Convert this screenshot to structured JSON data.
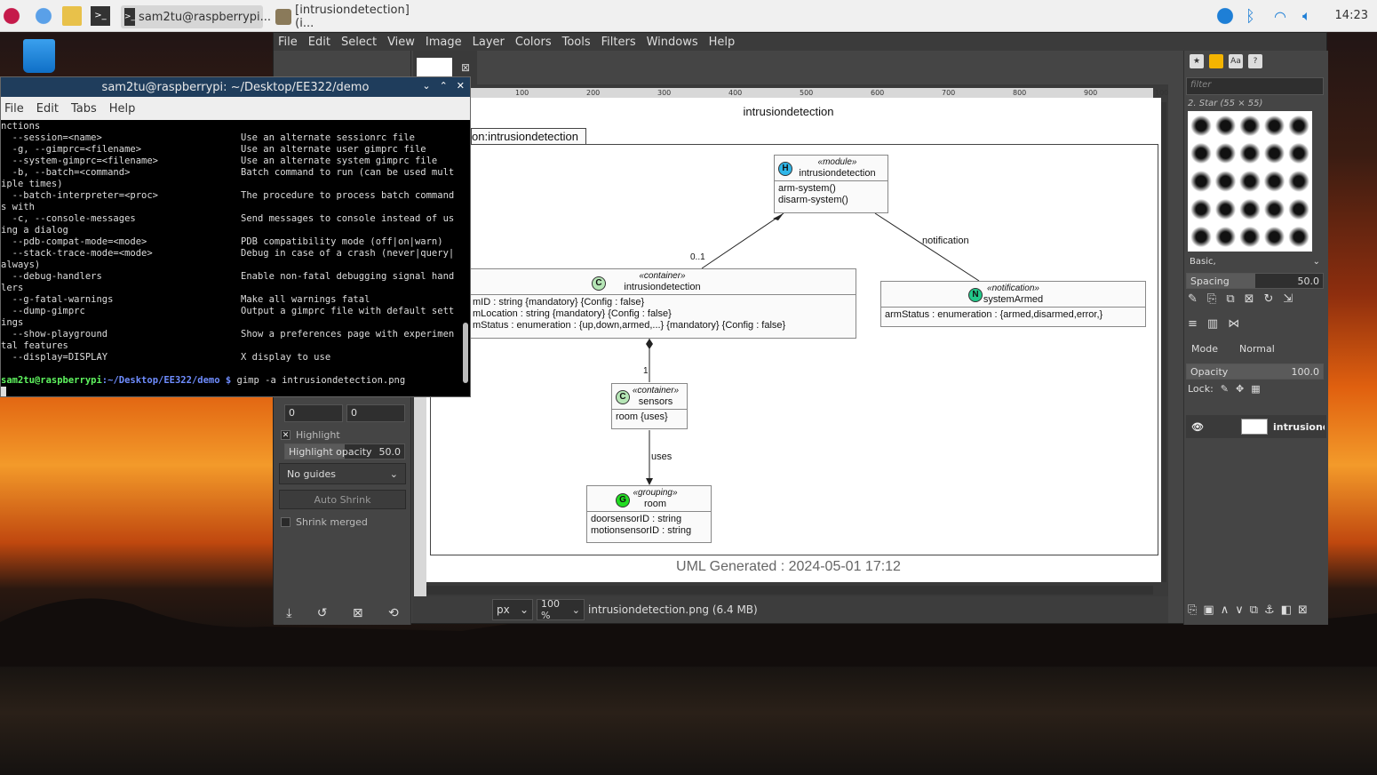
{
  "taskbar": {
    "tasks": [
      {
        "label": "sam2tu@raspberrypi..."
      },
      {
        "label": "[intrusiondetection] (i..."
      }
    ],
    "clock": "14:23"
  },
  "terminal": {
    "title": "sam2tu@raspberrypi: ~/Desktop/EE322/demo",
    "menu": [
      "File",
      "Edit",
      "Tabs",
      "Help"
    ],
    "lines": [
      [
        "nctions",
        ""
      ],
      [
        "  --session=<name>",
        "Use an alternate sessionrc file"
      ],
      [
        "  -g, --gimprc=<filename>",
        "Use an alternate user gimprc file"
      ],
      [
        "  --system-gimprc=<filename>",
        "Use an alternate system gimprc file"
      ],
      [
        "  -b, --batch=<command>",
        "Batch command to run (can be used mult"
      ],
      [
        "iple times)",
        ""
      ],
      [
        "  --batch-interpreter=<proc>",
        "The procedure to process batch command"
      ],
      [
        "s with",
        ""
      ],
      [
        "  -c, --console-messages",
        "Send messages to console instead of us"
      ],
      [
        "ing a dialog",
        ""
      ],
      [
        "  --pdb-compat-mode=<mode>",
        "PDB compatibility mode (off|on|warn)"
      ],
      [
        "  --stack-trace-mode=<mode>",
        "Debug in case of a crash (never|query|"
      ],
      [
        "always)",
        ""
      ],
      [
        "  --debug-handlers",
        "Enable non-fatal debugging signal hand"
      ],
      [
        "lers",
        ""
      ],
      [
        "  --g-fatal-warnings",
        "Make all warnings fatal"
      ],
      [
        "  --dump-gimprc",
        "Output a gimprc file with default sett"
      ],
      [
        "ings",
        ""
      ],
      [
        "  --show-playground",
        "Show a preferences page with experimen"
      ],
      [
        "tal features",
        ""
      ],
      [
        "  --display=DISPLAY",
        "X display to use"
      ]
    ],
    "prompt_user": "sam2tu@raspberrypi",
    "prompt_path": ":~/Desktop/EE322/demo $",
    "command": " gimp -a intrusiondetection.png"
  },
  "gimp": {
    "menu": [
      "File",
      "Edit",
      "Select",
      "View",
      "Image",
      "Layer",
      "Colors",
      "Tools",
      "Filters",
      "Windows",
      "Help"
    ],
    "tool_options": {
      "spin1": "0",
      "spin2": "0",
      "highlight": "Highlight",
      "highlight_opacity_label": "Highlight opacity",
      "highlight_opacity": "50.0",
      "highlight_opacity_frac": 0.5,
      "guides": "No guides",
      "auto_shrink": "Auto Shrink",
      "shrink_merged": "Shrink merged"
    },
    "rulers": [
      "100",
      "200",
      "300",
      "400",
      "500",
      "600",
      "700",
      "800",
      "900",
      "100"
    ],
    "status": {
      "unit": "px",
      "zoom": "100 %",
      "file": "intrusiondetection.png (6.4 MB)"
    },
    "dock": {
      "filter_placeholder": "filter",
      "brush_name": "2. Star (55 × 55)",
      "brush_tag": "Basic,",
      "spacing_label": "Spacing",
      "spacing": "50.0",
      "spacing_frac": 0.5,
      "mode_label": "Mode",
      "mode": "Normal",
      "opacity_label": "Opacity",
      "opacity": "100.0",
      "opacity_frac": 1.0,
      "lock_label": "Lock:",
      "layer_name": "intrusiondetection"
    }
  },
  "diagram": {
    "title": "intrusiondetection",
    "package": "on:intrusiondetection",
    "footer": "UML Generated : 2024-05-01 17:12",
    "module": {
      "badge": "H",
      "stereo": "«module»",
      "name": "intrusiondetection",
      "ops": [
        "arm-system()",
        "disarm-system()"
      ]
    },
    "container_main": {
      "badge": "C",
      "stereo": "«container»",
      "name": "intrusiondetection",
      "attrs": [
        "mID : string   {mandatory} {Config : false}",
        "mLocation : string   {mandatory} {Config : false}",
        "mStatus : enumeration : {up,down,armed,...}   {mandatory} {Config : false}"
      ]
    },
    "notification": {
      "badge": "N",
      "stereo": "«notification»",
      "name": "systemArmed",
      "attrs": [
        "armStatus : enumeration : {armed,disarmed,error,}"
      ]
    },
    "sensors": {
      "badge": "C",
      "stereo": "«container»",
      "name": "sensors",
      "attrs": [
        "room {uses}"
      ]
    },
    "grouping": {
      "badge": "G",
      "stereo": "«grouping»",
      "name": "room",
      "attrs": [
        "doorsensorID : string",
        "motionsensorID : string"
      ]
    },
    "labels": {
      "mult1": "0..1",
      "notif": "notification",
      "mult2": "1",
      "uses": "uses"
    }
  },
  "colors": {
    "module": "#2fb6e8",
    "container": "#b6e6b6",
    "notification": "#22c98a",
    "grouping": "#22dd22"
  }
}
